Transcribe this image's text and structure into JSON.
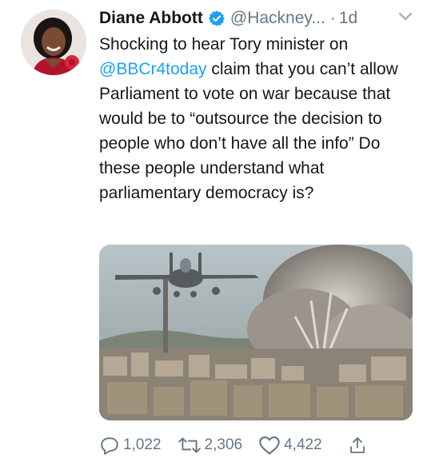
{
  "tweet": {
    "author_name": "Diane Abbott",
    "handle": "@Hackney...",
    "separator": "·",
    "time": "1d",
    "text_line1_prefix": "Shocking to hear Tory minister on",
    "mention": "@BBCr4today",
    "text_rest": " claim that you can’t allow Parliament to vote on war because that would be to “outsource the decision to people who don’t have all the info” Do these people understand what parliamentary democracy is?"
  },
  "actions": {
    "replies": "1,022",
    "retweets": "2,306",
    "likes": "4,422"
  },
  "icons": {
    "verified": "verified-badge-icon",
    "more": "chevron-down-icon",
    "reply": "reply-icon",
    "retweet": "retweet-icon",
    "like": "heart-icon",
    "share": "share-icon"
  },
  "colors": {
    "link": "#1da1f2",
    "muted": "#657786",
    "text": "#14171a"
  }
}
